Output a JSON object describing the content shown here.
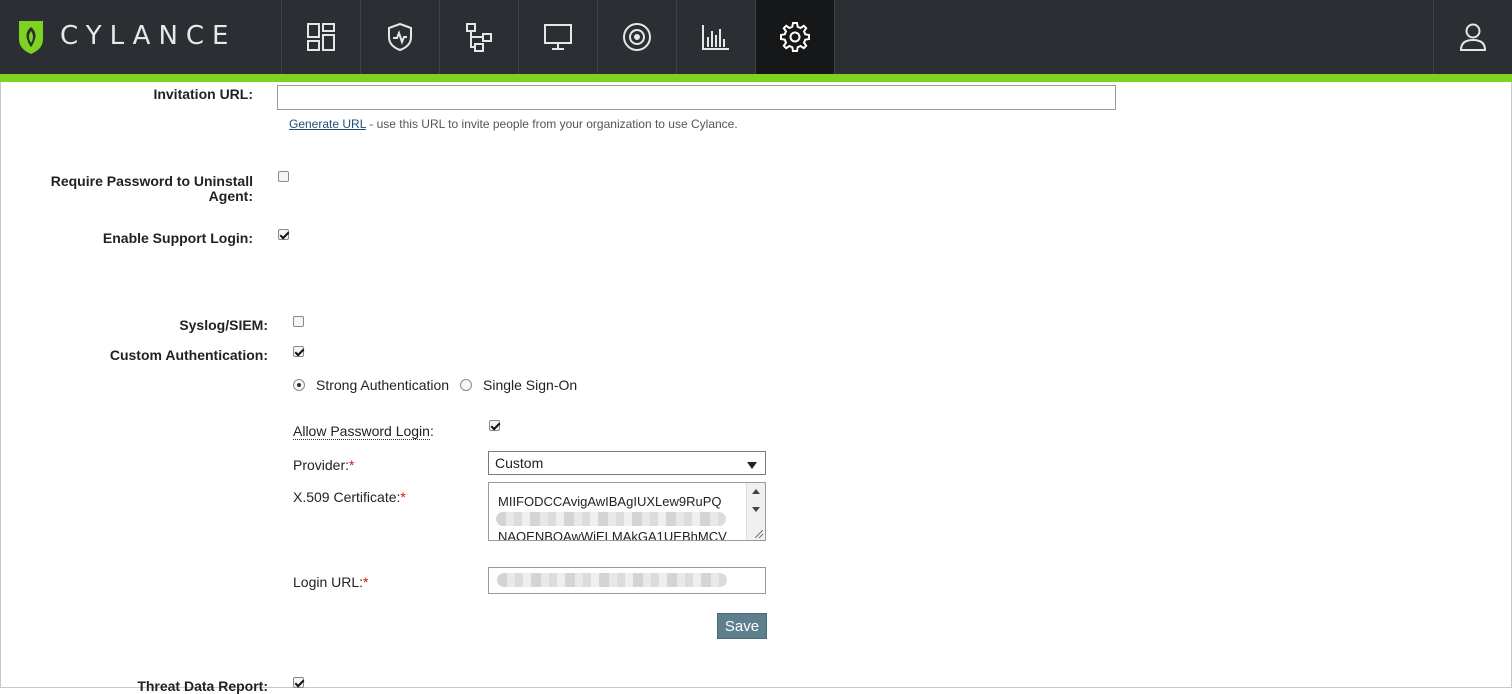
{
  "brand": {
    "name": "CYLANCE",
    "accent": "#7ed321",
    "nav_bg": "#2b2f33"
  },
  "nav": [
    {
      "icon": "dashboard-icon",
      "active": false
    },
    {
      "icon": "shield-pulse-icon",
      "active": false
    },
    {
      "icon": "hierarchy-icon",
      "active": false
    },
    {
      "icon": "monitor-icon",
      "active": false
    },
    {
      "icon": "target-icon",
      "active": false
    },
    {
      "icon": "bar-chart-icon",
      "active": false
    },
    {
      "icon": "gear-icon",
      "active": true
    }
  ],
  "user_icon": "user-icon",
  "form": {
    "invitation_url": {
      "label": "Invitation URL:",
      "value": "",
      "generate_link": "Generate URL",
      "hint": " - use this URL to invite people from your organization to use Cylance."
    },
    "require_password": {
      "label_line1": "Require Password to Uninstall",
      "label_line2": "Agent:",
      "checked": false
    },
    "support_login": {
      "label": "Enable Support Login:",
      "checked": true
    },
    "syslog": {
      "label": "Syslog/SIEM:",
      "checked": false
    },
    "custom_auth": {
      "label": "Custom Authentication:",
      "checked": true,
      "options": [
        "Strong Authentication",
        "Single Sign-On"
      ],
      "selected": "Strong Authentication",
      "allow_password_login": {
        "label": "Allow Password Login",
        "colon": ":",
        "checked": true
      },
      "provider": {
        "label": "Provider:",
        "required": "*",
        "value": "Custom"
      },
      "certificate": {
        "label": "X.509 Certificate:",
        "required": "*",
        "line1": "MIIFODCCAvigAwIBAgIUXLew9RuPQ",
        "line3": "NAOENBOAwWiELMAkGA1UEBhMCV"
      },
      "login_url": {
        "label": "Login URL:",
        "required": "*"
      },
      "save_label": "Save"
    },
    "threat_data": {
      "label": "Threat Data Report:",
      "checked": true
    }
  }
}
